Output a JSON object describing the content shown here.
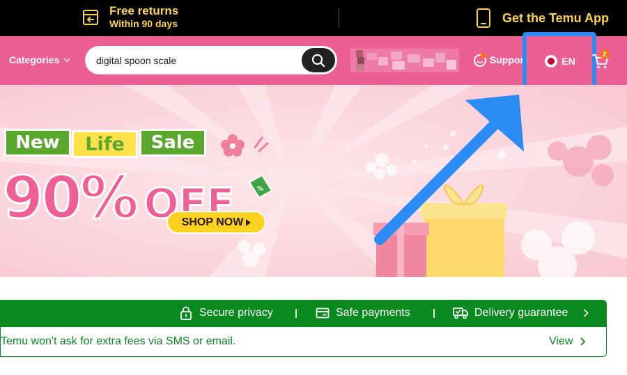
{
  "topbar": {
    "returns_title": "Free returns",
    "returns_subtitle": "Within 90 days",
    "app_label": "Get the Temu App"
  },
  "nav": {
    "categories_label": "Categories",
    "search_value": "digital spoon scale",
    "support_label": "Support",
    "language_label": "EN",
    "cart_count": "2"
  },
  "banner": {
    "word1": "New",
    "word2": "Life",
    "word3": "Sale",
    "discount": "90%",
    "off_label": "OFF",
    "cta_label": "SHOP NOW"
  },
  "trust": {
    "privacy_label": "Secure privacy",
    "payments_label": "Safe payments",
    "delivery_label": "Delivery guarantee",
    "notice_text": "Temu won't ask for extra fees via SMS or email.",
    "view_label": "View"
  },
  "colors": {
    "nav_pink": "#ec5f92",
    "promo_yellow": "#fcd34d",
    "trust_green": "#0a8a1e",
    "highlight_blue": "#2b8cf5"
  },
  "icons": [
    "return-box-icon",
    "phone-icon",
    "chevron-down-icon",
    "search-icon",
    "support-icon",
    "flag-icon",
    "cart-icon",
    "lock-icon",
    "card-icon",
    "truck-icon",
    "chevron-right-icon",
    "annotation-arrow"
  ]
}
